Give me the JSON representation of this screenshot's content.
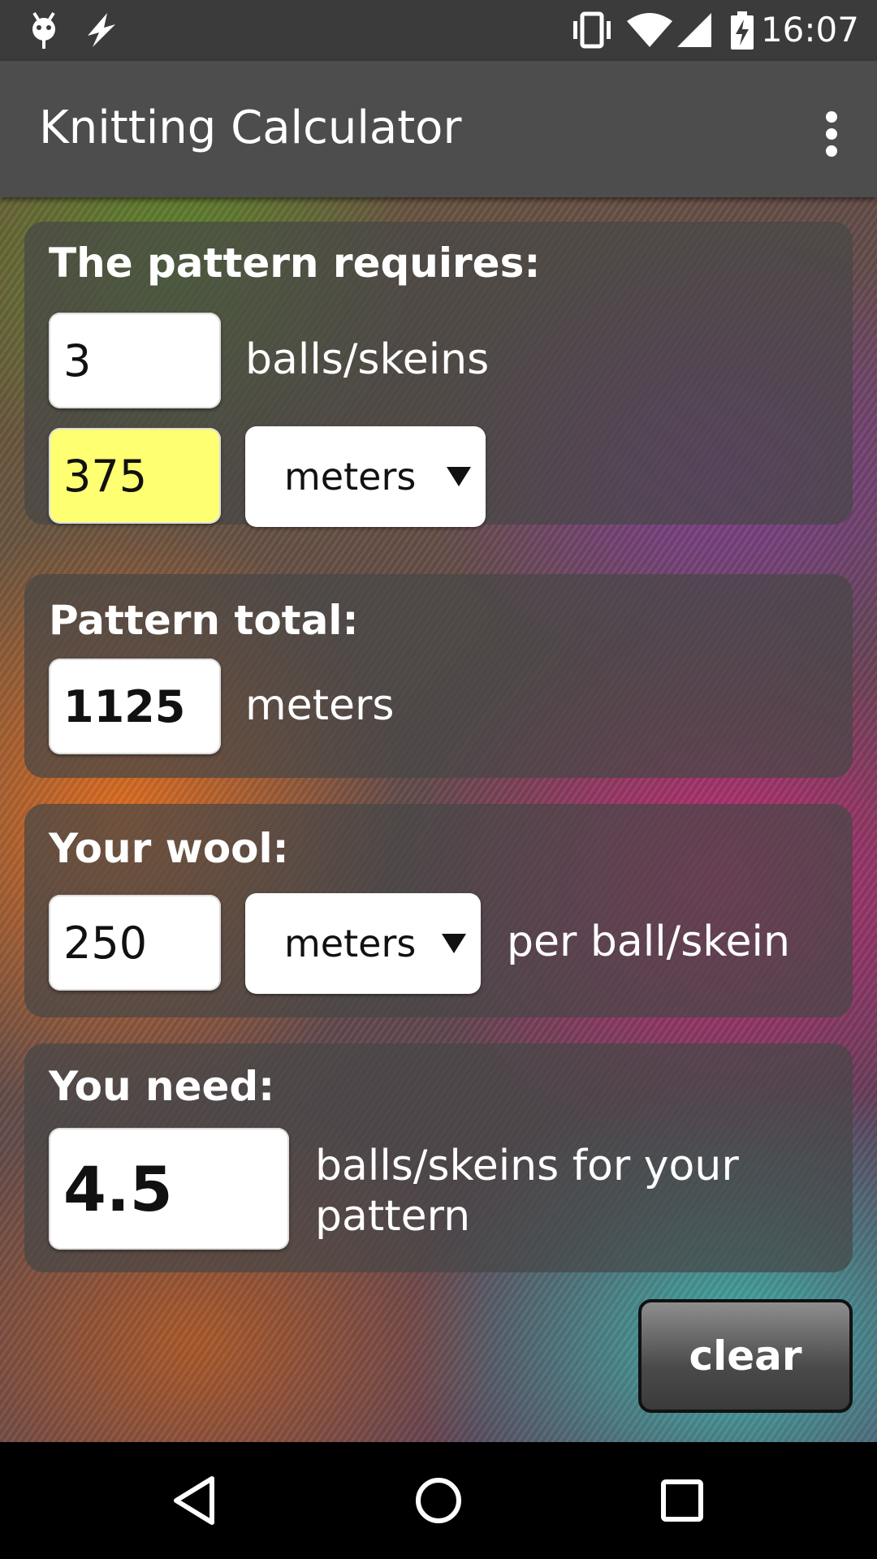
{
  "status_bar": {
    "time": "16:07",
    "icons": [
      "android-icon",
      "lightning-icon",
      "vibrate-icon",
      "wifi-icon",
      "signal-icon",
      "battery-charging-icon"
    ]
  },
  "app_bar": {
    "title": "Knitting Calculator",
    "overflow_icon": "more-vert-icon"
  },
  "pattern_requires": {
    "title": "The pattern requires:",
    "count_value": "3",
    "count_unit": "balls/skeins",
    "length_value": "375",
    "length_unit_selected": "meters"
  },
  "pattern_total": {
    "title": "Pattern total:",
    "value": "1125",
    "unit": "meters"
  },
  "your_wool": {
    "title": "Your wool:",
    "value": "250",
    "unit_selected": "meters",
    "suffix": "per ball/skein"
  },
  "you_need": {
    "title": "You need:",
    "value": "4.5",
    "suffix": "balls/skeins for your pattern"
  },
  "clear_label": "clear",
  "colors": {
    "highlight_field": "#ffff72",
    "app_bar": "#4d4d4d",
    "status_bar": "#3b3b3b"
  },
  "nav_bar": {
    "icons": [
      "back-icon",
      "home-icon",
      "recents-icon"
    ]
  }
}
